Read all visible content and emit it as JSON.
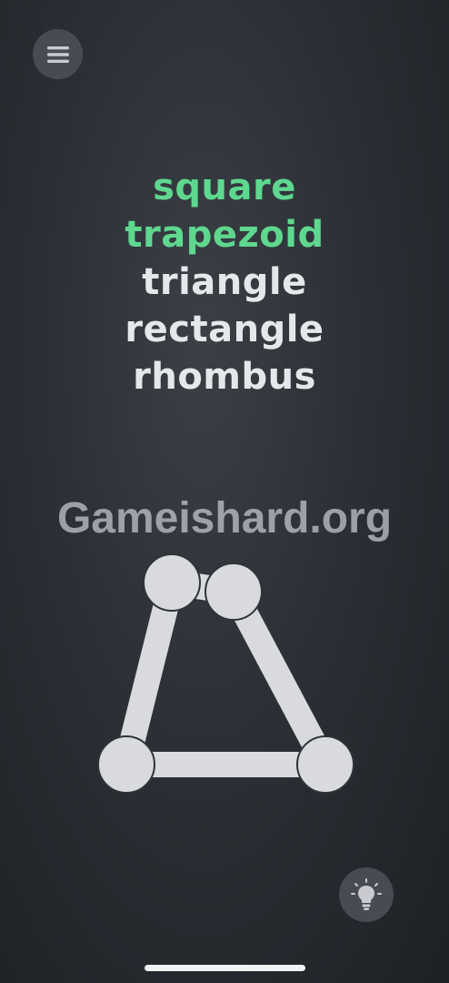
{
  "menu": {
    "icon": "hamburger-menu-icon"
  },
  "words": [
    {
      "label": "square",
      "solved": true
    },
    {
      "label": "trapezoid",
      "solved": true
    },
    {
      "label": "triangle",
      "solved": false
    },
    {
      "label": "rectangle",
      "solved": false
    },
    {
      "label": "rhombus",
      "solved": false
    }
  ],
  "watermark": "Gameishard.org",
  "puzzle": {
    "node_color": "#d9dadd",
    "edge_color": "#d9dadd",
    "node_count": 5,
    "edges": [
      [
        0,
        1
      ],
      [
        0,
        3
      ],
      [
        1,
        2
      ],
      [
        2,
        4
      ],
      [
        3,
        4
      ]
    ]
  },
  "hint": {
    "icon": "lightbulb-icon"
  },
  "colors": {
    "solved_word": "#5fd88f",
    "unsolved_word": "#e6e7ea",
    "button_bg": "#474b52"
  }
}
